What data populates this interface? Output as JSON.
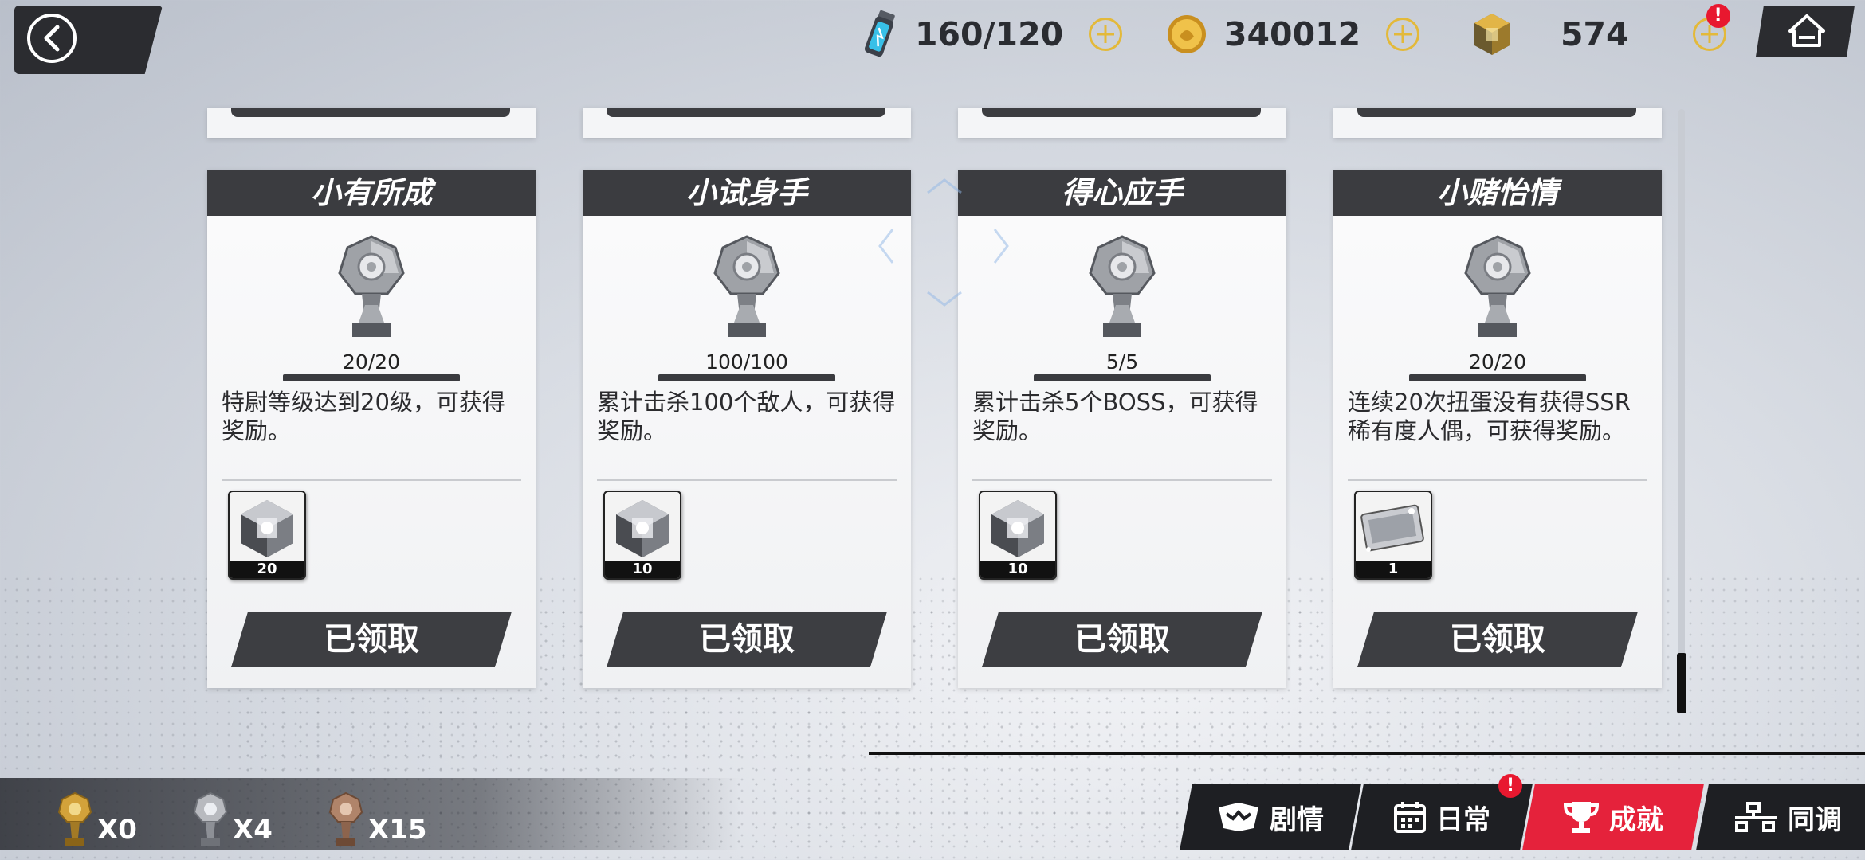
{
  "header": {
    "resources": [
      {
        "name": "stamina",
        "icon": "energy-vial-icon",
        "value": "160/120"
      },
      {
        "name": "coins",
        "icon": "gold-coin-icon",
        "value": "340012"
      },
      {
        "name": "crystals",
        "icon": "crystal-cube-icon",
        "value": "574",
        "badge": "!"
      }
    ]
  },
  "achievements": [
    {
      "title": "小有所成",
      "progress": "20/20",
      "description": "特尉等级达到20级，可获得奖励。",
      "reward_count": "20",
      "reward_icon": "crystal-cube-icon",
      "button": "已领取"
    },
    {
      "title": "小试身手",
      "progress": "100/100",
      "description": "累计击杀100个敌人，可获得奖励。",
      "reward_count": "10",
      "reward_icon": "crystal-cube-icon",
      "button": "已领取"
    },
    {
      "title": "得心应手",
      "progress": "5/5",
      "description": "累计击杀5个BOSS，可获得奖励。",
      "reward_count": "10",
      "reward_icon": "crystal-cube-icon",
      "button": "已领取"
    },
    {
      "title": "小赌怡情",
      "progress": "20/20",
      "description": "连续20次扭蛋没有获得SSR稀有度人偶，可获得奖励。",
      "reward_count": "1",
      "reward_icon": "ticket-card-icon",
      "button": "已领取"
    }
  ],
  "trophy_counts": [
    {
      "tier": "gold",
      "label": "X0",
      "color": "#d3a23a"
    },
    {
      "tier": "silver",
      "label": "X4",
      "color": "#b8babf"
    },
    {
      "tier": "bronze",
      "label": "X15",
      "color": "#b0846a"
    }
  ],
  "tabs": [
    {
      "label": "剧情",
      "icon": "story-mask-icon",
      "active": false
    },
    {
      "label": "日常",
      "icon": "calendar-icon",
      "active": false,
      "badge": "!"
    },
    {
      "label": "成就",
      "icon": "trophy-icon",
      "active": true
    },
    {
      "label": "同调",
      "icon": "sync-icon",
      "active": false
    }
  ],
  "colors": {
    "accent": "#e5223b",
    "gold": "#e3b93a",
    "card_header": "#3b3c40"
  }
}
